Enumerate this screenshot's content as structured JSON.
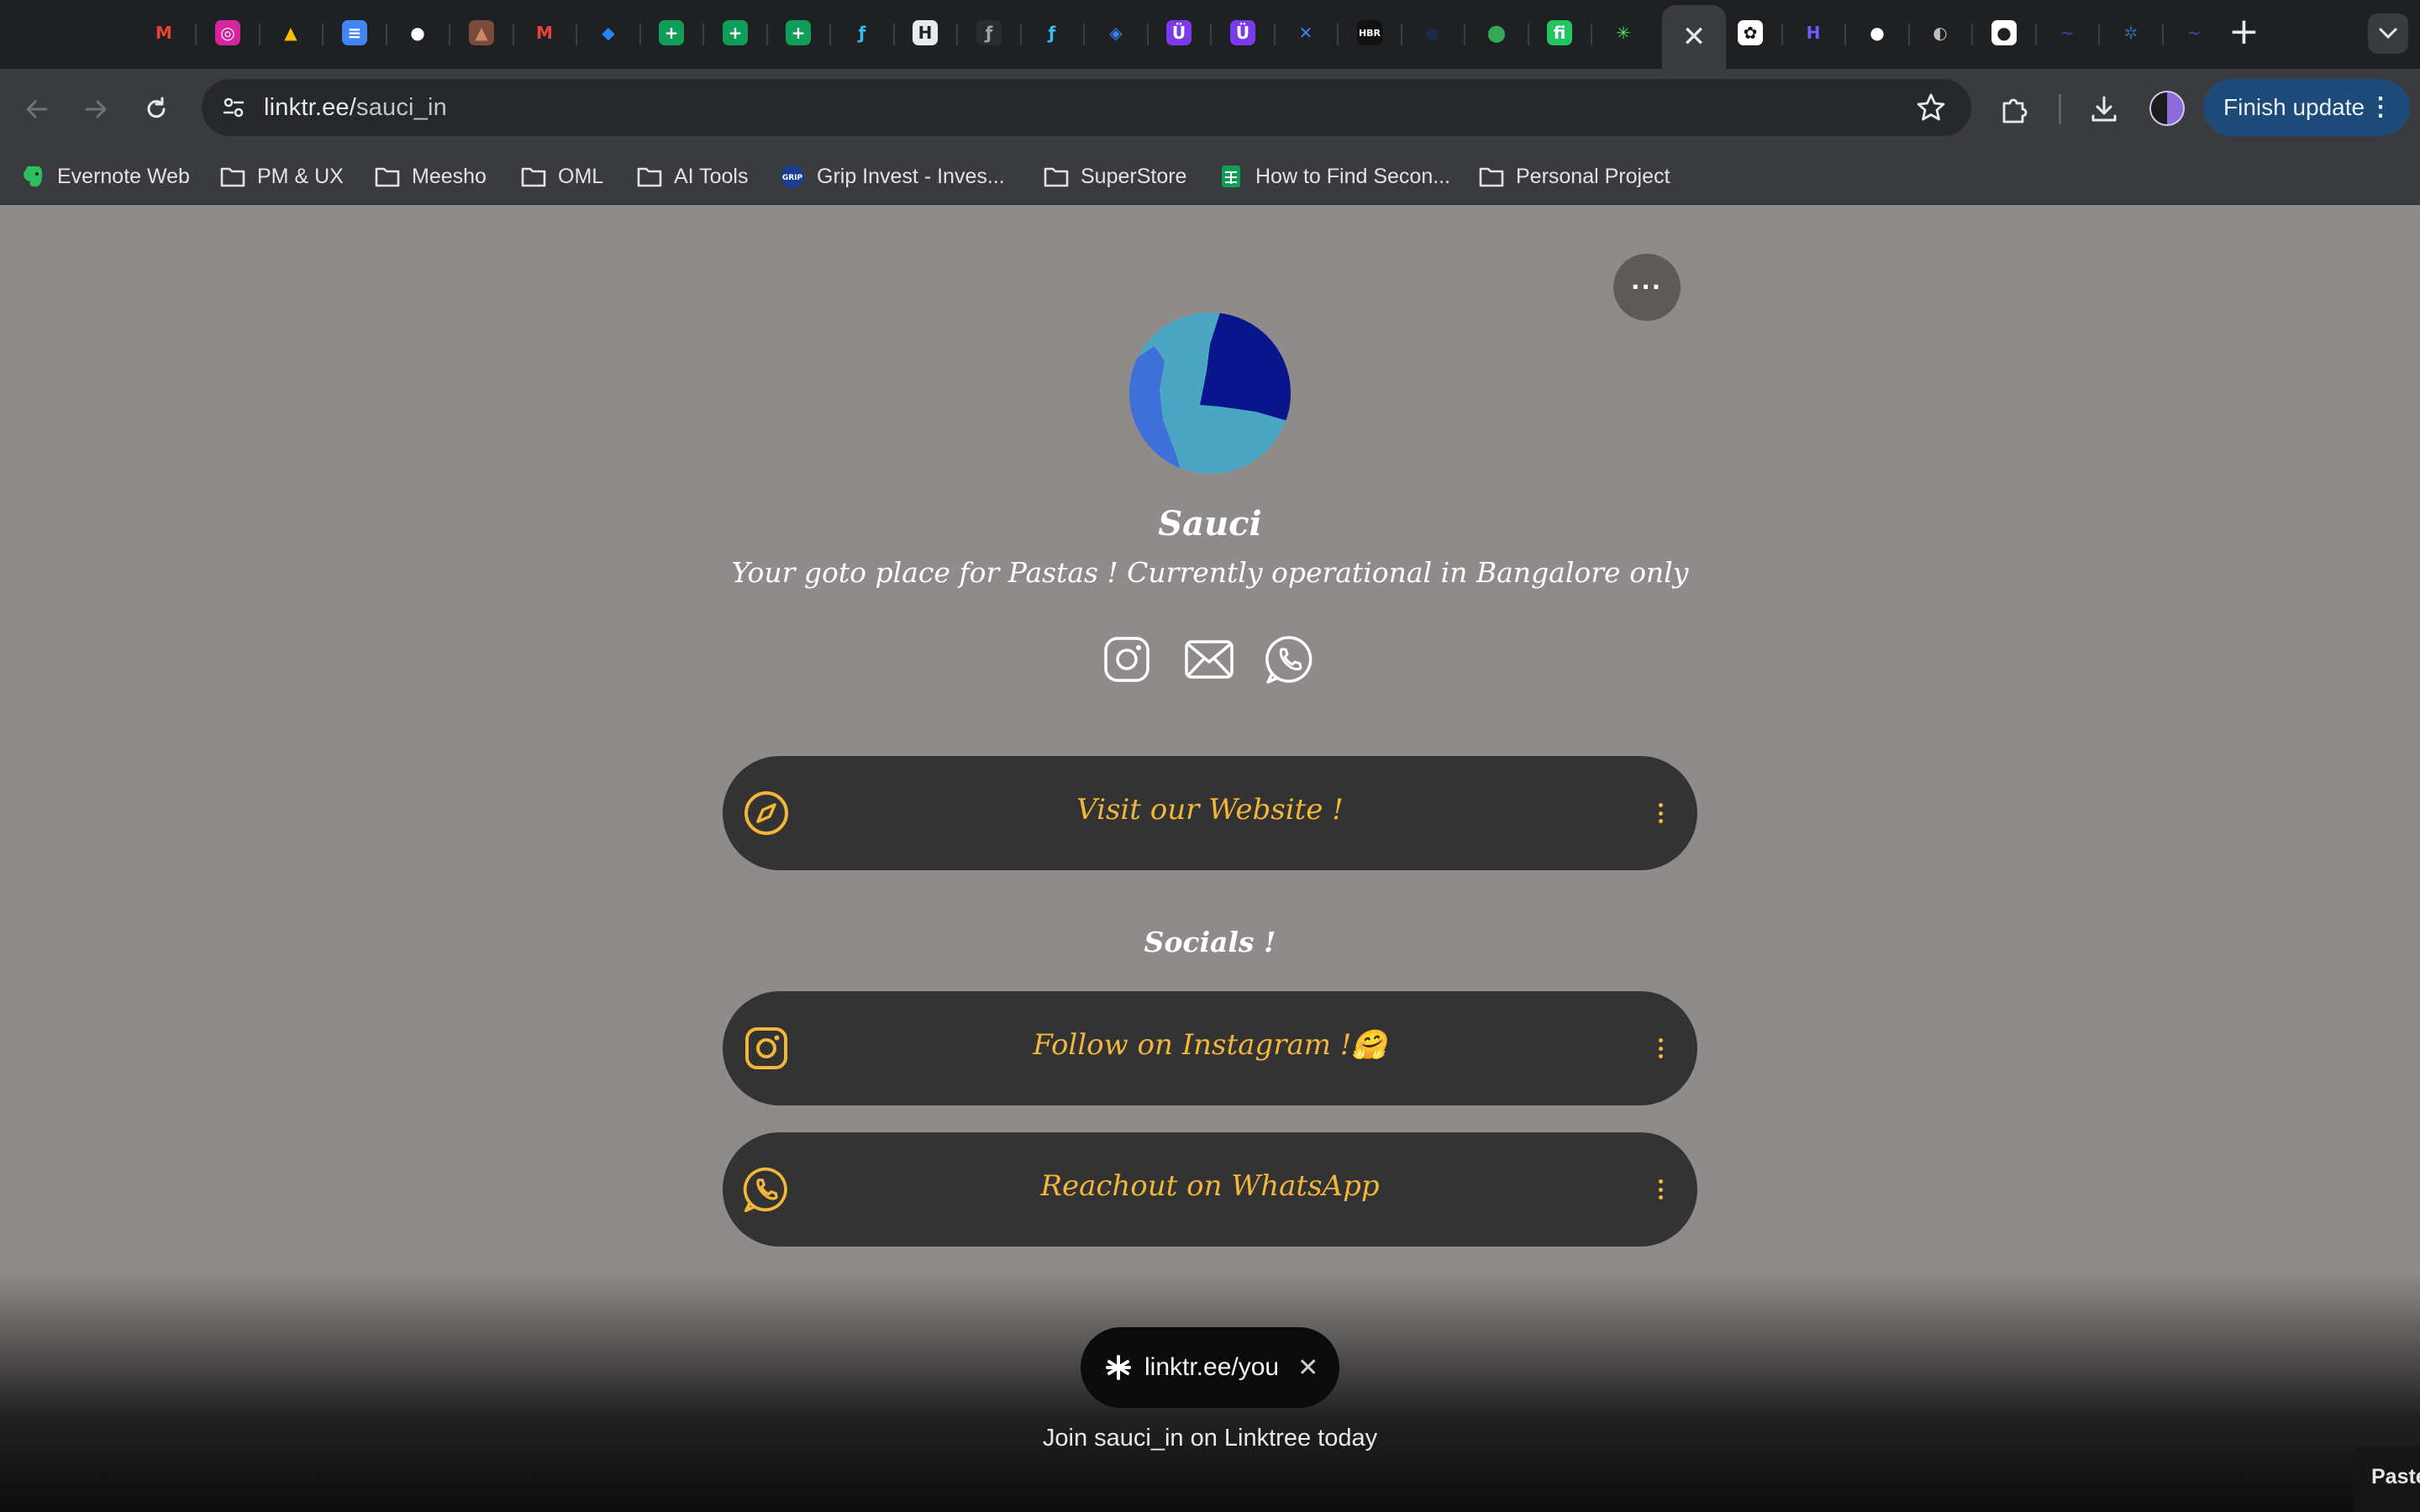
{
  "browser": {
    "tabs": [
      {
        "icon": "gmail-icon",
        "glyph": "M",
        "bg": "#1f2022",
        "fg": "#ea4335"
      },
      {
        "icon": "instagram-icon",
        "glyph": "◎",
        "bg": "#d6249f",
        "fg": "#ffffff"
      },
      {
        "icon": "google-drive-icon",
        "glyph": "▲",
        "bg": "#1f2022",
        "fg": "#fbbc04"
      },
      {
        "icon": "google-docs-icon",
        "glyph": "≡",
        "bg": "#4285f4",
        "fg": "#ffffff"
      },
      {
        "icon": "github-icon",
        "glyph": "●",
        "bg": "#1f2022",
        "fg": "#ffffff"
      },
      {
        "icon": "portrait-icon",
        "glyph": "▲",
        "bg": "#7a4b3a",
        "fg": "#c98a6a"
      },
      {
        "icon": "gmail-icon",
        "glyph": "M",
        "bg": "#1f2022",
        "fg": "#ea4335"
      },
      {
        "icon": "jira-icon",
        "glyph": "◆",
        "bg": "#1f2022",
        "fg": "#2684ff"
      },
      {
        "icon": "google-sheets-icon",
        "glyph": "+",
        "bg": "#0f9d58",
        "fg": "#ffffff"
      },
      {
        "icon": "google-sheets-icon",
        "glyph": "+",
        "bg": "#0f9d58",
        "fg": "#ffffff"
      },
      {
        "icon": "google-sheets-icon",
        "glyph": "+",
        "bg": "#0f9d58",
        "fg": "#ffffff"
      },
      {
        "icon": "feather-icon",
        "glyph": "ƒ",
        "bg": "#1f2022",
        "fg": "#38bdf8"
      },
      {
        "icon": "medium-icon",
        "glyph": "H",
        "bg": "#e8eaed",
        "fg": "#1f2022"
      },
      {
        "icon": "feather-circle-icon",
        "glyph": "ƒ",
        "bg": "#2b2c2f",
        "fg": "#9ca3af"
      },
      {
        "icon": "feather-icon",
        "glyph": "ƒ",
        "bg": "#1f2022",
        "fg": "#38bdf8"
      },
      {
        "icon": "tag-icon",
        "glyph": "◈",
        "bg": "#1f2022",
        "fg": "#3b82f6"
      },
      {
        "icon": "u-badge-icon",
        "glyph": "Ü",
        "bg": "#7c3aed",
        "fg": "#ffffff"
      },
      {
        "icon": "u-badge-icon",
        "glyph": "Ü",
        "bg": "#7c3aed",
        "fg": "#ffffff"
      },
      {
        "icon": "x-logo-icon",
        "glyph": "✕",
        "bg": "#1f2022",
        "fg": "#3b82f6"
      },
      {
        "icon": "hbr-icon",
        "glyph": "HBR",
        "bg": "#111111",
        "fg": "#ffffff"
      },
      {
        "icon": "globe-dark-icon",
        "glyph": "●",
        "bg": "#1f2022",
        "fg": "#1e2a44"
      },
      {
        "icon": "google-maps-icon",
        "glyph": "⬤",
        "bg": "#1f2022",
        "fg": "#34a853"
      },
      {
        "icon": "fi-icon",
        "glyph": "fi",
        "bg": "#22c55e",
        "fg": "#ffffff"
      },
      {
        "icon": "linktree-icon",
        "glyph": "✳",
        "bg": "#1f2022",
        "fg": "#43e660"
      },
      {
        "icon": "close-tab-icon",
        "glyph": "",
        "bg": "",
        "fg": ""
      },
      {
        "icon": "chatgpt-icon",
        "glyph": "✿",
        "bg": "#ffffff",
        "fg": "#111111"
      },
      {
        "icon": "h-logo-icon",
        "glyph": "H",
        "bg": "#1f2022",
        "fg": "#6d5dfc"
      },
      {
        "icon": "github-icon",
        "glyph": "●",
        "bg": "#1f2022",
        "fg": "#ffffff"
      },
      {
        "icon": "globe-icon",
        "glyph": "◐",
        "bg": "#1f2022",
        "fg": "#bdbdbd"
      },
      {
        "icon": "github-icon",
        "glyph": "●",
        "bg": "#ffffff",
        "fg": "#1f2022"
      },
      {
        "icon": "tilde-icon",
        "glyph": "~",
        "bg": "#1f2022",
        "fg": "#3b3f8f"
      },
      {
        "icon": "asterisk-icon",
        "glyph": "✲",
        "bg": "#1f2022",
        "fg": "#2d5fa8"
      },
      {
        "icon": "tilde-icon",
        "glyph": "~",
        "bg": "#1f2022",
        "fg": "#3b3f8f"
      }
    ],
    "url_host": "linktr.ee/",
    "url_path": "sauci_in",
    "update_label": "Finish update",
    "bookmarks": [
      {
        "label": "Evernote Web",
        "icon": "evernote-icon"
      },
      {
        "label": "PM & UX",
        "icon": "folder-icon"
      },
      {
        "label": "Meesho",
        "icon": "folder-icon"
      },
      {
        "label": "OML",
        "icon": "folder-icon"
      },
      {
        "label": "AI Tools",
        "icon": "folder-icon"
      },
      {
        "label": "Grip Invest - Inves...",
        "icon": "grip-icon"
      },
      {
        "label": "SuperStore",
        "icon": "folder-icon"
      },
      {
        "label": "How to Find Secon...",
        "icon": "sheets-icon"
      },
      {
        "label": "Personal Project",
        "icon": "folder-icon"
      }
    ]
  },
  "profile": {
    "more_label": "···",
    "name": "Sauci",
    "bio": "Your goto place for Pastas ! Currently operational in Bangalore only",
    "social_icons": [
      "instagram-icon",
      "mail-icon",
      "whatsapp-icon"
    ]
  },
  "links": [
    {
      "label": "Visit our Website !",
      "icon": "compass-icon"
    },
    {
      "label": "Follow on Instagram !🤗",
      "icon": "instagram-icon"
    },
    {
      "label": "Reachout on WhatsApp",
      "icon": "whatsapp-icon"
    }
  ],
  "sections": {
    "socials_header": "Socials !"
  },
  "footer": {
    "claim_text": "linktr.ee/you",
    "join_text": "Join sauci_in on Linktree today",
    "corner_text": "Paste"
  },
  "colors": {
    "page_bg": "#8f8b8a",
    "card_bg": "#343333",
    "accent": "#f2b63a",
    "update_btn": "#1d4a78"
  }
}
